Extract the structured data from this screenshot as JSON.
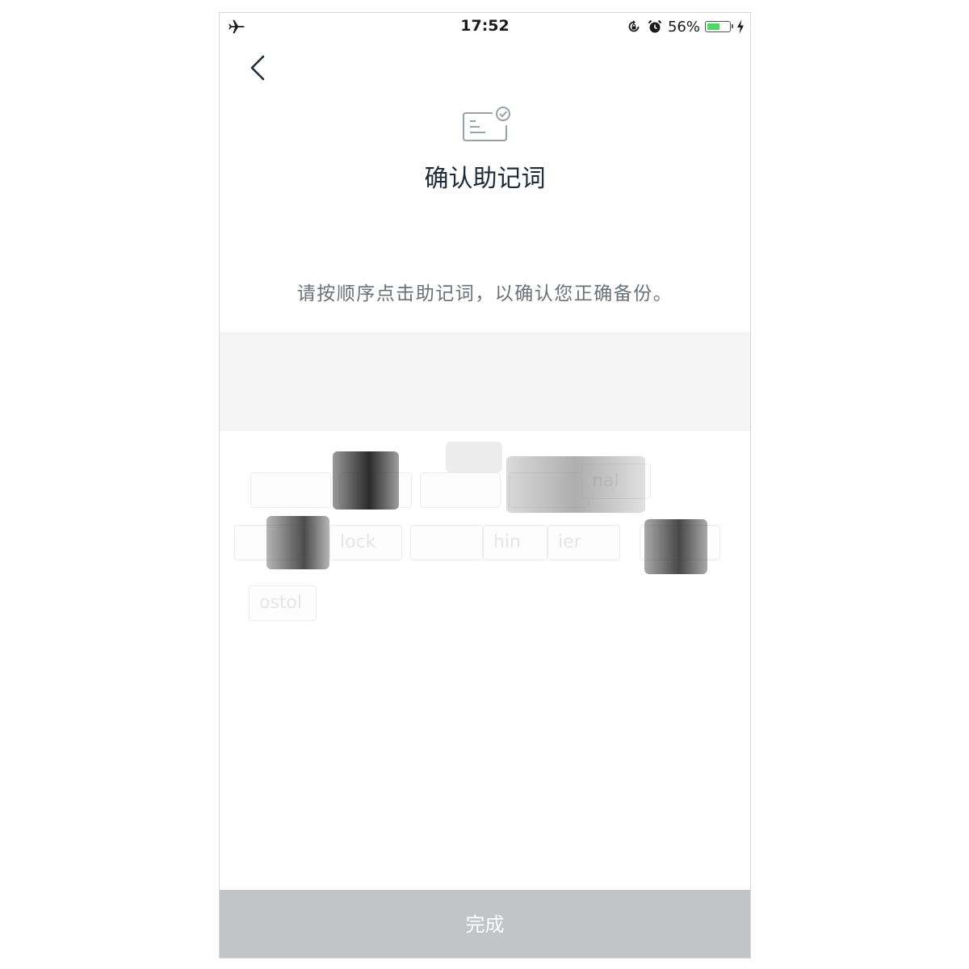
{
  "status_bar": {
    "time": "17:52",
    "battery_percent": "56%",
    "battery_level": 0.56,
    "icons": [
      "airplane-icon",
      "orientation-lock-icon",
      "alarm-icon",
      "battery-icon",
      "charging-icon"
    ]
  },
  "header": {
    "back_icon": "chevron-left-icon",
    "page_icon": "document-check-icon",
    "title": "确认助记词"
  },
  "instruction": "请按顺序点击助记词，以确认您正确备份。",
  "word_chips": [
    "",
    "",
    "",
    "",
    "nal",
    "",
    "lock",
    "",
    "hin",
    "ier",
    "",
    "ostol"
  ],
  "done_button": {
    "label": "完成"
  },
  "colors": {
    "title": "#1d2a38",
    "instruction": "#6b7178",
    "selected_area_bg": "#f5f5f5",
    "done_button_bg": "#c1c5c8",
    "battery_fill": "#4cd964"
  }
}
